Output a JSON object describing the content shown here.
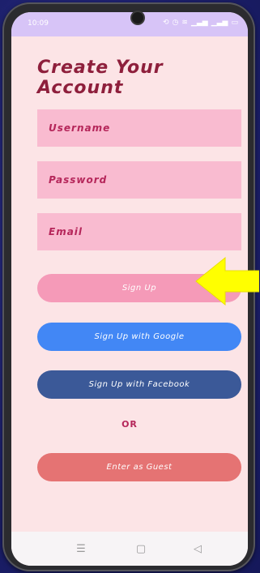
{
  "status_bar": {
    "time": "10:09",
    "icons": [
      "sync-icon",
      "alarm-icon",
      "wifi-icon",
      "signal-icon",
      "signal-icon",
      "battery-icon"
    ]
  },
  "screen": {
    "title": "Create Your Account"
  },
  "form": {
    "username_placeholder": "Username",
    "password_placeholder": "Password",
    "email_placeholder": "Email"
  },
  "buttons": {
    "sign_up": "Sign Up",
    "google": "Sign Up with Google",
    "facebook": "Sign Up with Facebook",
    "or": "OR",
    "guest": "Enter as Guest"
  },
  "colors": {
    "background": "#fce4e6",
    "status_bar": "#d7c4f7",
    "title": "#8e1f3c",
    "field": "#f9bbd0",
    "sign_up": "#f59ab8",
    "google": "#4287f5",
    "facebook": "#3b5998",
    "guest": "#e57373",
    "arrow": "#ffff00"
  },
  "nav_bar": {
    "icons": [
      "menu-icon",
      "home-icon",
      "back-icon"
    ]
  }
}
